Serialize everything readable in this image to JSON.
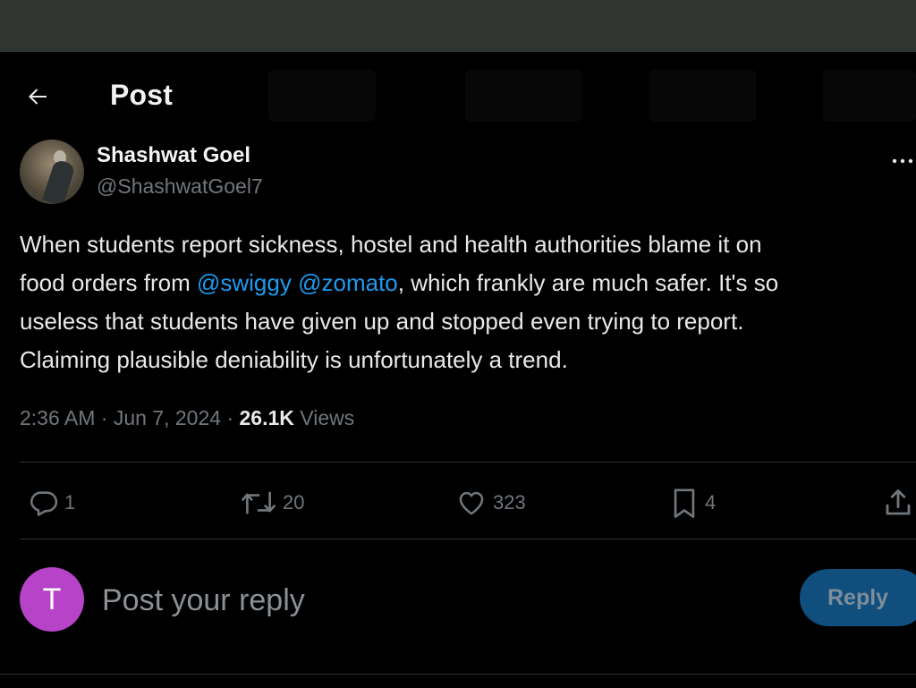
{
  "header": {
    "title": "Post"
  },
  "author": {
    "name": "Shashwat Goel",
    "handle": "@ShashwatGoel7"
  },
  "tweet": {
    "lines": [
      [
        "When students report sickness, hostel and health authorities blame it on"
      ],
      [
        "food orders from ",
        "@swiggy",
        " ",
        "@zomato",
        ", which frankly are much safer. It's so"
      ],
      [
        "useless that students have given up and stopped even trying to report."
      ],
      [
        "Claiming plausible deniability is unfortunately a trend."
      ]
    ],
    "line1": "When students report sickness, hostel and health authorities blame it on",
    "line2_pre": "food orders from ",
    "mention1": "@swiggy",
    "space": " ",
    "mention2": "@zomato",
    "line2_post": ", which frankly are much safer. It's so",
    "line3": "useless that students have given up and stopped even trying to report.",
    "line4": "Claiming plausible deniability is unfortunately a trend."
  },
  "meta": {
    "time": "2:36 AM",
    "sep1": " · ",
    "date": "Jun 7, 2024",
    "sep2": " · ",
    "views_count": "26.1K",
    "views_label": " Views"
  },
  "actions": {
    "replies": "1",
    "reposts": "20",
    "likes": "323",
    "bookmarks": "4"
  },
  "reply": {
    "avatar_letter": "T",
    "placeholder": "Post your reply",
    "button_label": "Reply"
  },
  "colors": {
    "background": "#000000",
    "topbar": "#313532",
    "accent": "#1d9bf0",
    "muted_text": "#71767b",
    "reply_avatar": "#b743c8",
    "reply_button": "#0f4e7d"
  },
  "icons": {
    "back": "arrow-left-icon",
    "more": "more-horizontal-icon",
    "reply": "speech-bubble-icon",
    "repost": "repost-icon",
    "like": "heart-icon",
    "bookmark": "bookmark-icon",
    "share": "share-upload-icon"
  }
}
